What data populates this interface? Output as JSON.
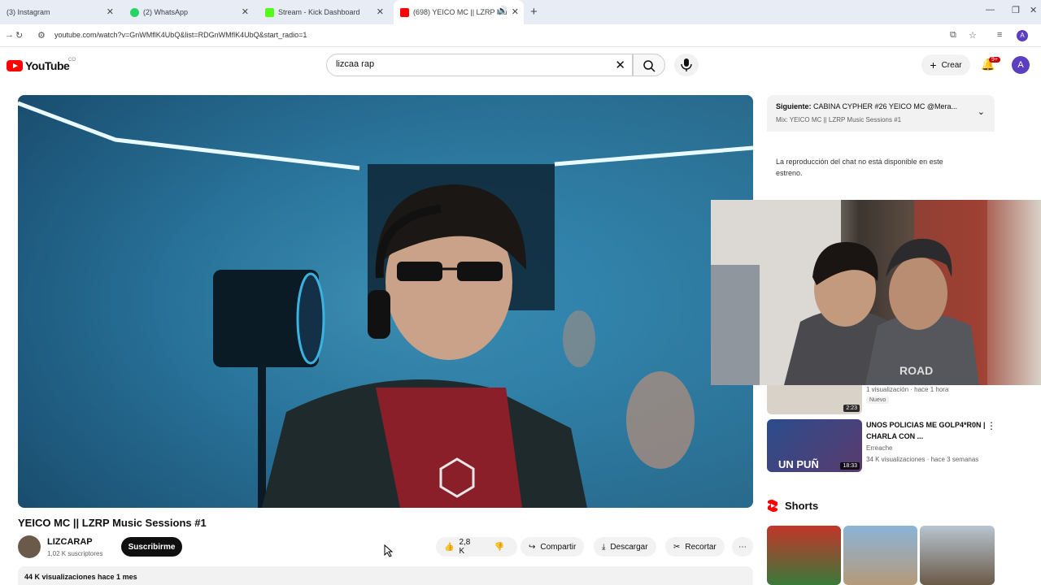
{
  "browser": {
    "tabs": [
      {
        "label": "(3) Instagram",
        "favicon_color": "#e1306c"
      },
      {
        "label": "(2) WhatsApp",
        "favicon_color": "#25d366"
      },
      {
        "label": "Stream - Kick Dashboard",
        "favicon_color": "#53fc18"
      },
      {
        "label": "(698) YEICO MC || LZRP Mu",
        "favicon_color": "#ff0000"
      }
    ],
    "url": "youtube.com/watch?v=GnWMflK4UbQ&list=RDGnWMflK4UbQ&start_radio=1"
  },
  "header": {
    "logo_text": "YouTube",
    "country_code": "CO",
    "search_value": "lizcaa rap",
    "create_label": "Crear",
    "notif_count": "9+",
    "user_initial": "A"
  },
  "video": {
    "title": "YEICO MC || LZRP Music Sessions #1",
    "channel_name": "LIZCARAP",
    "subscribers": "1,02 K suscriptores",
    "subscribe_label": "Suscribirme",
    "likes": "2,8 K",
    "share_label": "Compartir",
    "download_label": "Descargar",
    "clip_label": "Recortar",
    "views_line": "44 K visualizaciones  hace 1 mes"
  },
  "sidebar": {
    "next_prefix": "Siguiente:",
    "next_title": "CABINA CYPHER #26 YEICO MC @Mera...",
    "next_sub": "Mix: YEICO MC || LZRP Music Sessions #1",
    "chat_message": "La reproducción del chat no está disponible en este estreno.",
    "recs": [
      {
        "meta1": "1 visualización · hace 1 hora",
        "badge": "Nuevo",
        "duration": "2:23"
      },
      {
        "title": "UNOS POLICIAS ME GOLP4*R0N | CHARLA CON ...",
        "channel": "Erreache",
        "meta1": "34 K visualizaciones · hace 3 semanas",
        "duration": "18:33",
        "thumb_text": "UN PUÑ"
      }
    ],
    "shorts_label": "Shorts"
  }
}
